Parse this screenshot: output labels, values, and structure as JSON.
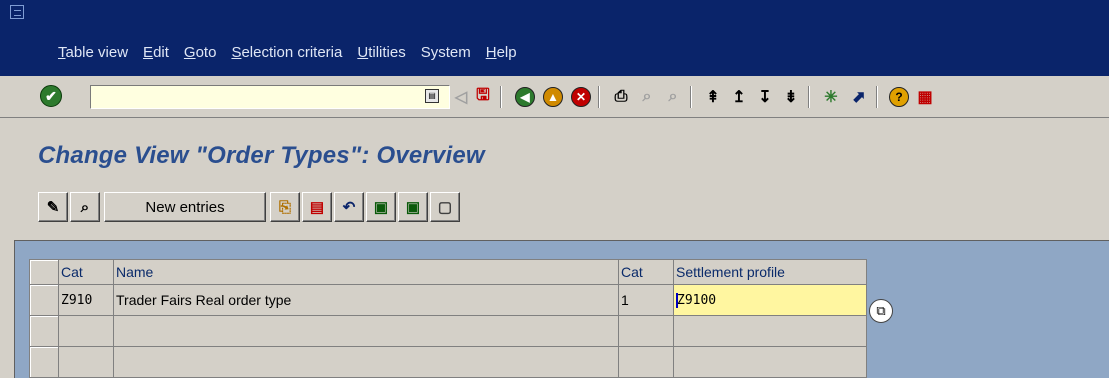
{
  "menu": [
    {
      "label": "Table view",
      "u": "T",
      "rest": "able view"
    },
    {
      "label": "Edit",
      "u": "E",
      "rest": "dit"
    },
    {
      "label": "Goto",
      "u": "G",
      "rest": "oto"
    },
    {
      "label": "Selection criteria",
      "u": "S",
      "rest": "election criteria"
    },
    {
      "label": "Utilities",
      "u": "U",
      "rest": "tilities"
    },
    {
      "label": "System",
      "u": "",
      "rest": "System"
    },
    {
      "label": "Help",
      "u": "H",
      "rest": "elp"
    }
  ],
  "toolbar": {
    "command_field": ""
  },
  "page": {
    "title": "Change View \"Order Types\": Overview"
  },
  "app_toolbar": {
    "new_entries_label": "New entries"
  },
  "table": {
    "headers": [
      "Cat",
      "Name",
      "Cat",
      "Settlement profile"
    ],
    "rows": [
      [
        "Z910",
        "Trader Fairs Real order type",
        "1",
        "Z9100"
      ],
      [
        "",
        "",
        "",
        ""
      ],
      [
        "",
        "",
        "",
        ""
      ]
    ]
  },
  "colors": {
    "title_bar": "#0a246a",
    "title_text": "#2a4e8f",
    "content_bg": "#8fa7c5",
    "input_yellow": "#fff6a0"
  }
}
